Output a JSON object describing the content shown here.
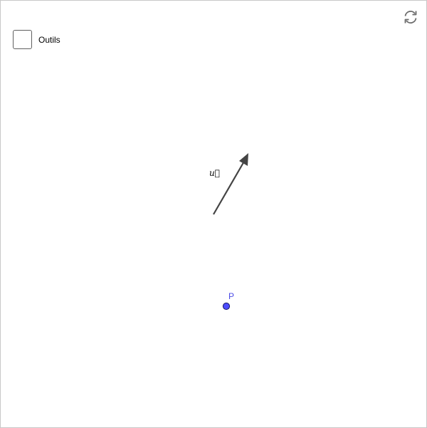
{
  "toolbar": {
    "tools_checkbox_label": "Outils",
    "tools_checkbox_checked": false
  },
  "reset_icon": "refresh-icon",
  "construction": {
    "vector": {
      "name": "u",
      "label": "u⃗",
      "color": "#444444"
    },
    "point": {
      "name": "P",
      "label": "P",
      "color": "#4a4ae6",
      "fill": "#4d4dff"
    }
  },
  "colors": {
    "border": "#c8c8c8",
    "background": "#ffffff"
  }
}
